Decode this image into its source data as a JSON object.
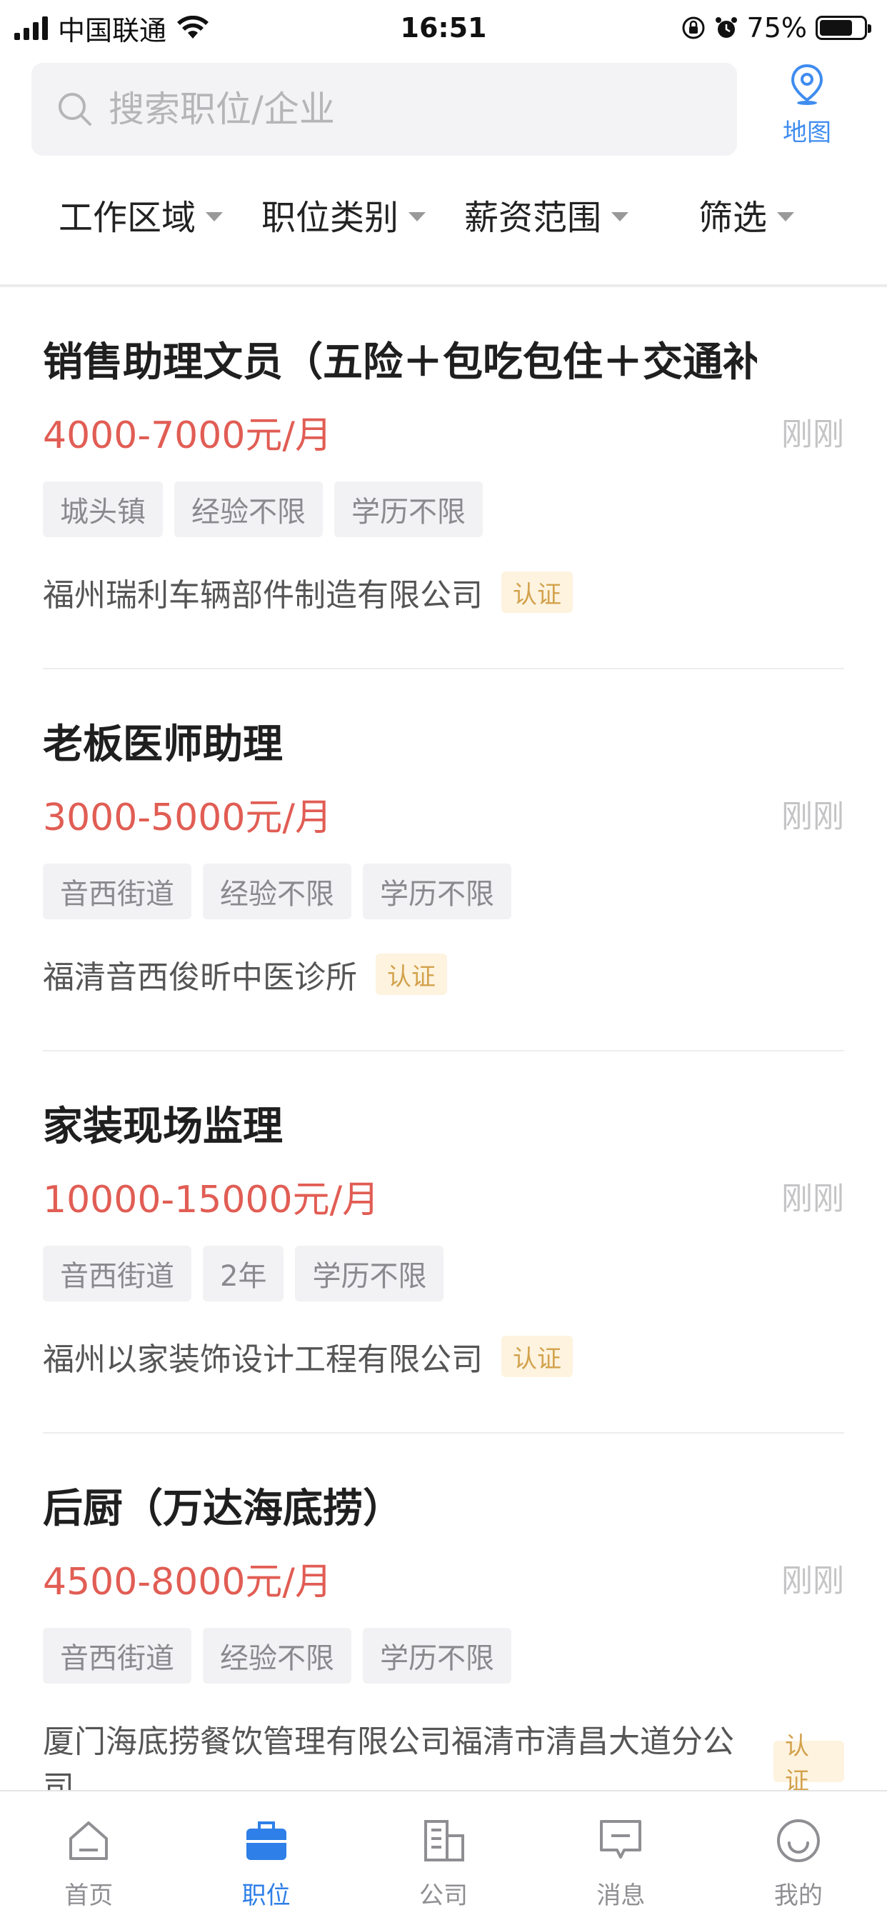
{
  "status_bar": {
    "carrier": "中国联通",
    "time": "16:51",
    "battery_text": "75%",
    "battery_level": 0.75,
    "icons": [
      "signal-icon",
      "wifi-icon",
      "orientation-lock-icon",
      "alarm-icon",
      "battery-icon"
    ]
  },
  "search": {
    "placeholder": "搜索职位/企业"
  },
  "map": {
    "label": "地图"
  },
  "filters": [
    {
      "label": "工作区域"
    },
    {
      "label": "职位类别"
    },
    {
      "label": "薪资范围"
    },
    {
      "label": "筛选"
    }
  ],
  "jobs": [
    {
      "title": "销售助理文员（五险＋包吃包住＋交通补...",
      "salary": "4000-7000元/月",
      "time": "刚刚",
      "tags": [
        "城头镇",
        "经验不限",
        "学历不限"
      ],
      "company": "福州瑞利车辆部件制造有限公司",
      "badge": "认证"
    },
    {
      "title": "老板医师助理",
      "salary": "3000-5000元/月",
      "time": "刚刚",
      "tags": [
        "音西街道",
        "经验不限",
        "学历不限"
      ],
      "company": "福清音西俊昕中医诊所",
      "badge": "认证"
    },
    {
      "title": "家装现场监理",
      "salary": "10000-15000元/月",
      "time": "刚刚",
      "tags": [
        "音西街道",
        "2年",
        "学历不限"
      ],
      "company": "福州以家装饰设计工程有限公司",
      "badge": "认证"
    },
    {
      "title": "后厨（万达海底捞）",
      "salary": "4500-8000元/月",
      "time": "刚刚",
      "tags": [
        "音西街道",
        "经验不限",
        "学历不限"
      ],
      "company": "厦门海底捞餐饮管理有限公司福清市清昌大道分公司",
      "badge": "认证"
    }
  ],
  "tabs": [
    {
      "label": "首页",
      "icon": "home-icon",
      "active": false
    },
    {
      "label": "职位",
      "icon": "briefcase-icon",
      "active": true
    },
    {
      "label": "公司",
      "icon": "building-icon",
      "active": false
    },
    {
      "label": "消息",
      "icon": "message-icon",
      "active": false
    },
    {
      "label": "我的",
      "icon": "profile-icon",
      "active": false
    }
  ],
  "colors": {
    "accent": "#2f7fe8",
    "salary": "#e15d54",
    "badge_bg": "#fdf3df",
    "badge_text": "#d3a24d"
  }
}
